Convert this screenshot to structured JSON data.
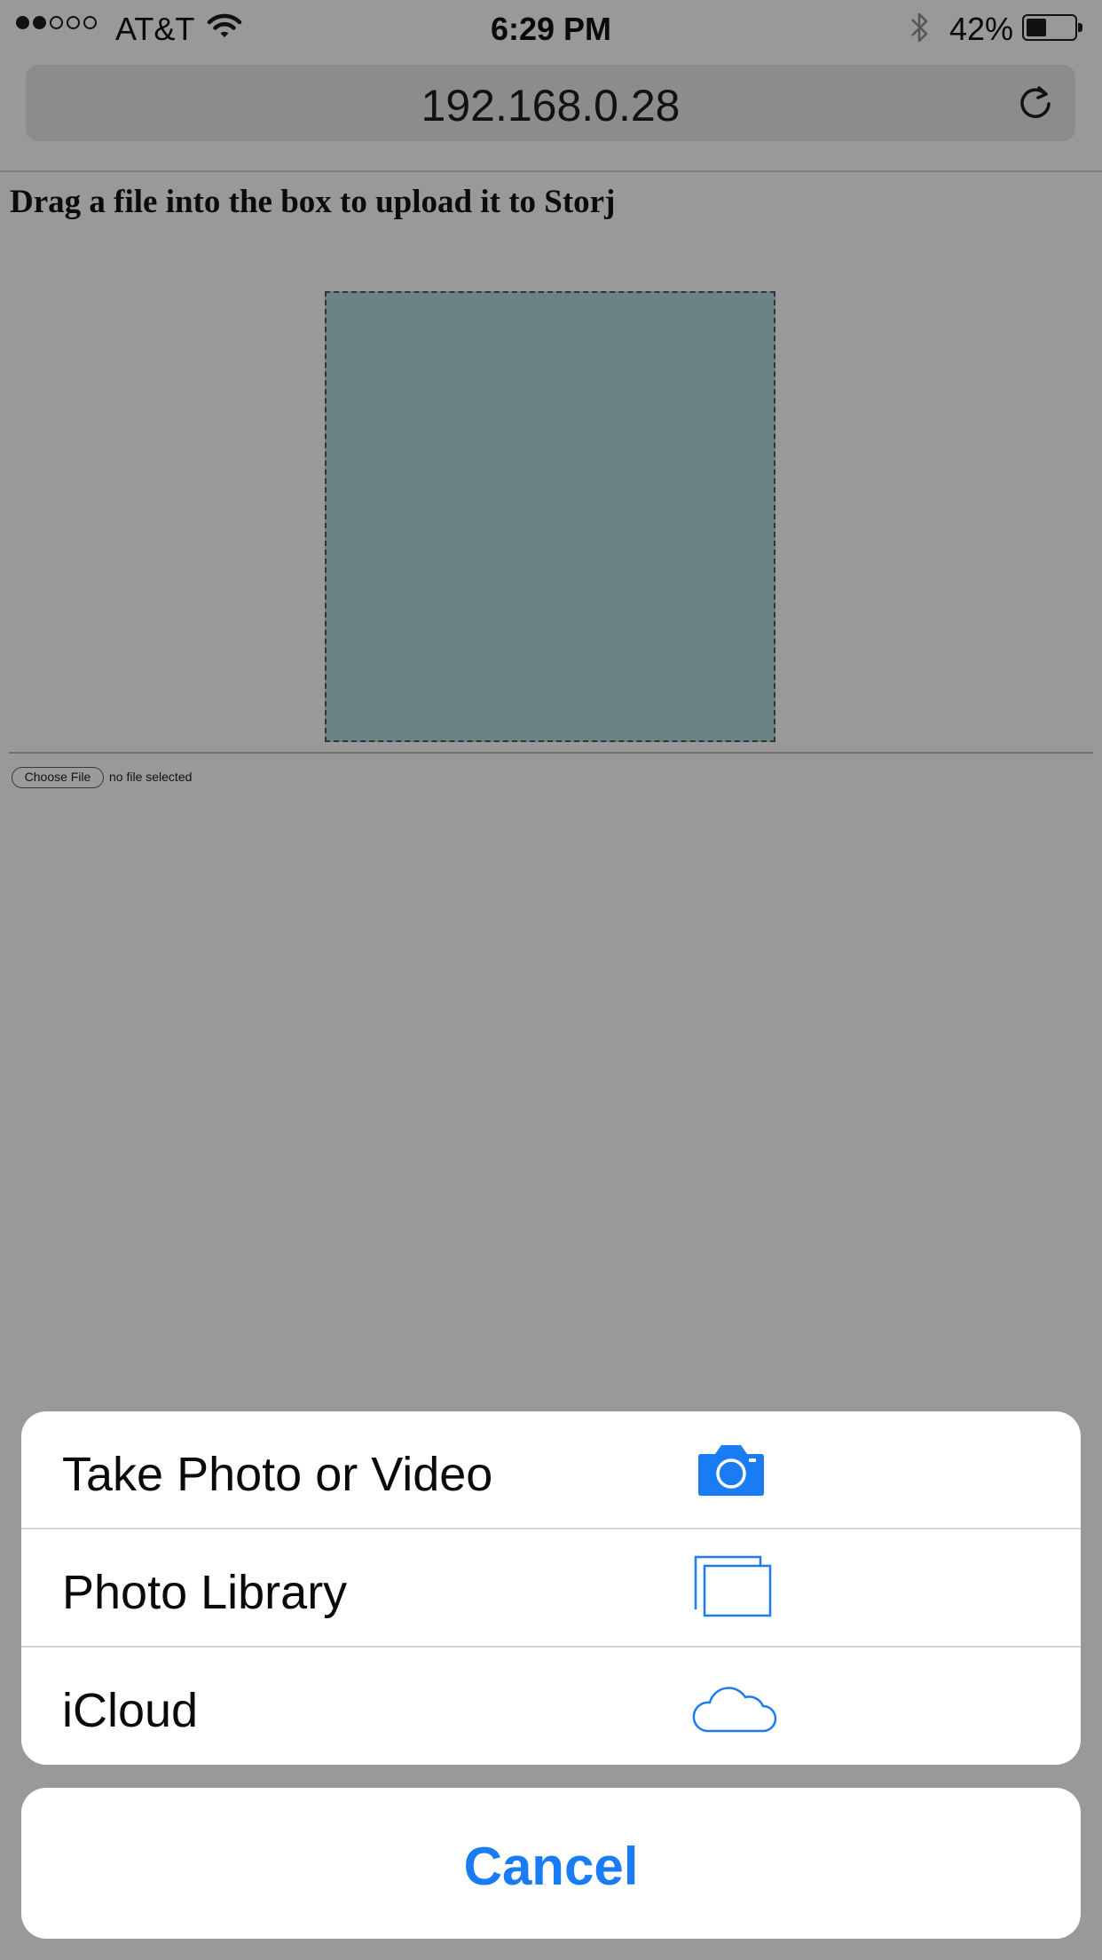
{
  "status_bar": {
    "carrier": "AT&T",
    "time": "6:29 PM",
    "battery_percent": "42%",
    "battery_level": 0.42,
    "signal_bars_filled": 2,
    "signal_bars_total": 5,
    "icons": [
      "signal-dots-icon",
      "wifi-icon",
      "bluetooth-icon",
      "battery-icon"
    ]
  },
  "browser": {
    "url": "192.168.0.28",
    "icons": [
      "reload-icon"
    ]
  },
  "page": {
    "heading": "Drag a file into the box to upload it to Storj",
    "drop_zone_color": "#6b8287",
    "file_input": {
      "button_label": "Choose File",
      "status": "no file selected"
    }
  },
  "action_sheet": {
    "items": [
      {
        "label": "Take Photo or Video",
        "icon": "camera-icon"
      },
      {
        "label": "Photo Library",
        "icon": "photo-library-icon"
      },
      {
        "label": "iCloud",
        "icon": "icloud-icon"
      }
    ],
    "cancel_label": "Cancel",
    "accent_color": "#1a7cf5"
  }
}
